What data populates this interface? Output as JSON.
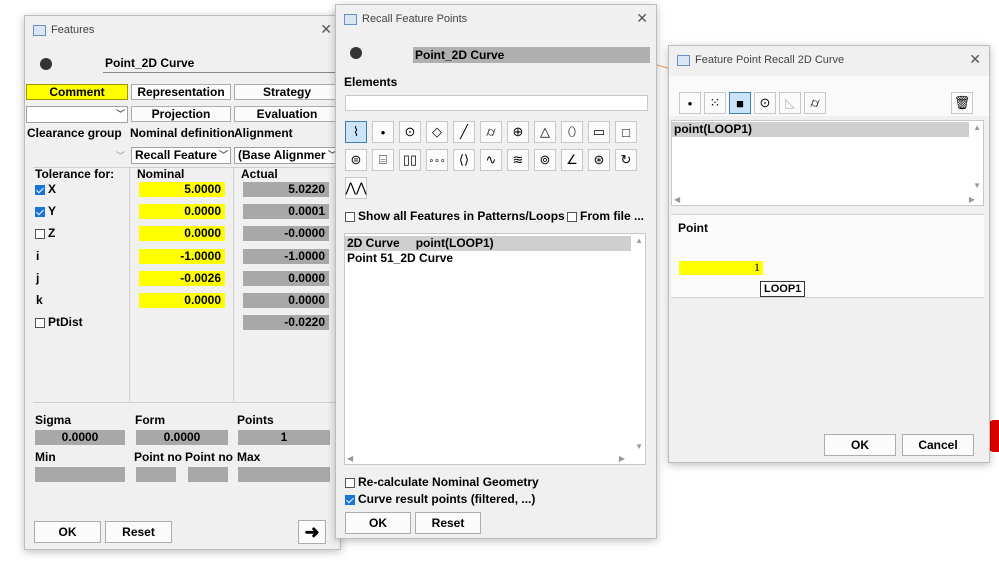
{
  "features_window": {
    "title": "Features",
    "feature_name": "Point_2D Curve",
    "tabs": [
      "Comment",
      "Representation",
      "Strategy"
    ],
    "projection_label": "Projection",
    "evaluation_label": "Evaluation",
    "clearance_group_label": "Clearance group",
    "nominal_definition_label": "Nominal definition",
    "alignment_label": "Alignment",
    "nominal_definition_value": "Recall Feature",
    "alignment_value": "(Base Alignmer",
    "tolerance_for_label": "Tolerance for:",
    "nominal_header": "Nominal",
    "actual_header": "Actual",
    "rows": [
      {
        "label": "X",
        "checked": true,
        "nominal": "5.0000",
        "actual": "5.0220"
      },
      {
        "label": "Y",
        "checked": true,
        "nominal": "0.0000",
        "actual": "0.0001"
      },
      {
        "label": "Z",
        "checked": false,
        "nominal": "0.0000",
        "actual": "-0.0000"
      },
      {
        "label": "i",
        "nominal": "-1.0000",
        "actual": "-1.0000"
      },
      {
        "label": "j",
        "nominal": "-0.0026",
        "actual": "0.0000"
      },
      {
        "label": "k",
        "nominal": "0.0000",
        "actual": "0.0000"
      },
      {
        "label": "PtDist",
        "checked": false,
        "nominal": "",
        "actual": "-0.0220"
      }
    ],
    "sigma_label": "Sigma",
    "form_label": "Form",
    "points_label": "Points",
    "sigma_value": "0.0000",
    "form_value": "0.0000",
    "points_value": "1",
    "min_label": "Min",
    "point_no_label_1": "Point no",
    "point_no_label_2": "Point no",
    "max_label": "Max",
    "ok_label": "OK",
    "reset_label": "Reset"
  },
  "recall_window": {
    "title": "Recall Feature Points",
    "feature_name": "Point_2D Curve",
    "elements_label": "Elements",
    "element_icons": [
      "2d-curve-icon",
      "point-icon",
      "circle-icon",
      "plane-icon",
      "line-icon",
      "cylinder-icon",
      "sphere-icon",
      "cone-icon",
      "ellipse-icon",
      "slot-icon",
      "rectangle-icon",
      "torus-icon",
      "stud-icon",
      "double-cylinder-icon",
      "point-set-icon",
      "symmetry-icon",
      "curve-icon",
      "surface-icon",
      "circle-point-icon",
      "angle-icon",
      "sphere-point-icon",
      "free-shape-icon",
      "zigzag-icon"
    ],
    "show_all_label": "Show all Features in Patterns/Loops",
    "from_file_label": "From file ...",
    "list_items": [
      {
        "name": "2D Curve",
        "detail": "point(LOOP1)"
      },
      {
        "name": "Point 51_2D Curve",
        "detail": ""
      }
    ],
    "recalc_label": "Re-calculate Nominal Geometry",
    "recalc_checked": false,
    "curve_result_label": "Curve result points (filtered, ...)",
    "curve_result_checked": true,
    "ok_label": "OK",
    "reset_label": "Reset"
  },
  "recall2d_window": {
    "title": "Feature Point Recall 2D Curve",
    "toolbar_icons": [
      "point-icon",
      "point-grid-icon",
      "box-icon",
      "circle-point-icon",
      "plane-icon",
      "cylinder-icon"
    ],
    "delete_icon": "trash-icon",
    "list_items": [
      "point(LOOP1)"
    ],
    "point_label": "Point",
    "point_value": "1",
    "tooltip": "LOOP1",
    "ok_label": "OK",
    "cancel_label": "Cancel"
  },
  "colors": {
    "yellow": "#ffff00",
    "gray_field": "#a8a8a8",
    "accent": "#1a73d8"
  }
}
